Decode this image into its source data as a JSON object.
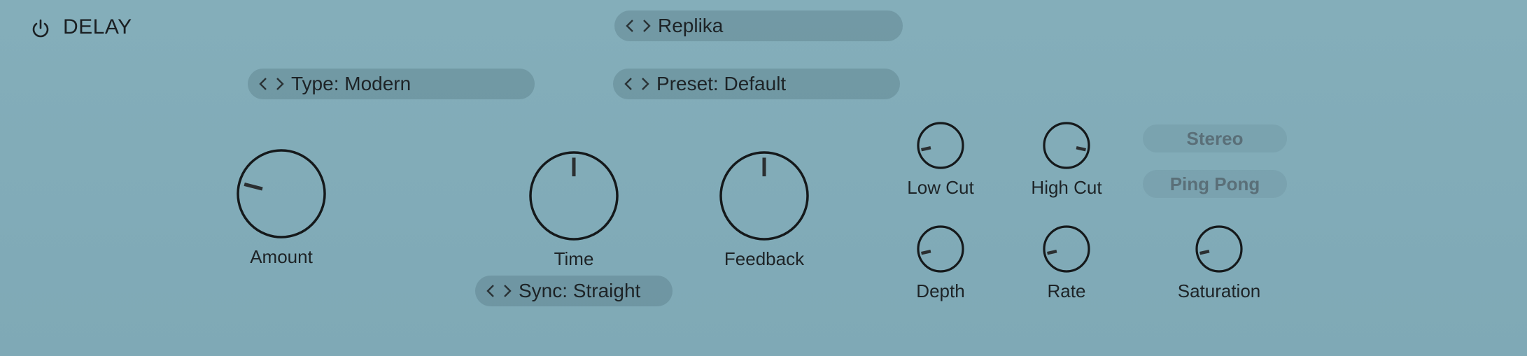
{
  "header": {
    "title": "DELAY",
    "power_icon": "power-icon"
  },
  "selectors": {
    "replika": "Replika",
    "type": "Type: Modern",
    "preset": "Preset: Default",
    "sync": "Sync: Straight"
  },
  "knobs": {
    "amount": {
      "label": "Amount",
      "value": 0.22
    },
    "time": {
      "label": "Time",
      "value": 0.5
    },
    "feedback": {
      "label": "Feedback",
      "value": 0.5
    },
    "low_cut": {
      "label": "Low Cut",
      "value": 0.12
    },
    "high_cut": {
      "label": "High Cut",
      "value": 0.88
    },
    "depth": {
      "label": "Depth",
      "value": 0.12
    },
    "rate": {
      "label": "Rate",
      "value": 0.12
    },
    "saturation": {
      "label": "Saturation",
      "value": 0.12
    }
  },
  "toggles": {
    "stereo": "Stereo",
    "ping_pong": "Ping Pong"
  },
  "colors": {
    "background": "#81abb8",
    "ink": "#1a1f22",
    "pill": "#6a8d99",
    "toggle_text": "#5a6f78"
  }
}
